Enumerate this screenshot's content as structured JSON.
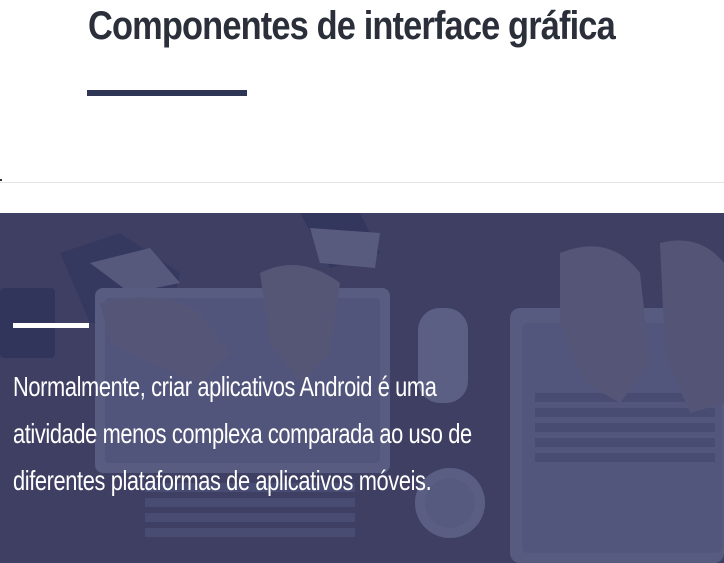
{
  "header": {
    "title": "Componentes de interface gráfica"
  },
  "hero": {
    "text": "Normalmente, criar aplicativos Android é uma atividade menos complexa comparada ao uso de diferentes plataformas de aplicativos móveis."
  },
  "colors": {
    "title": "#2a2f3a",
    "accent": "#2f3554",
    "overlay": "#343a68",
    "hero_text": "#ffffff"
  }
}
